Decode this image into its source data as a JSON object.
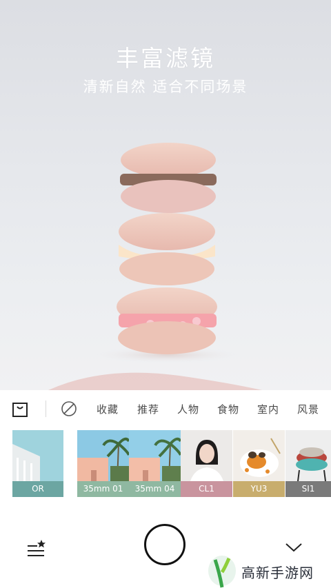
{
  "hero": {
    "title": "丰富滤镜",
    "subtitle": "清新自然 适合不同场景"
  },
  "category_bar": {
    "items": [
      "收藏",
      "推荐",
      "人物",
      "食物",
      "室内",
      "风景"
    ]
  },
  "filters": [
    {
      "label": "OR",
      "color": "#6ca6a2"
    },
    {
      "label": "35mm 01",
      "color": "#8fb8a1"
    },
    {
      "label": "35mm 04",
      "color": "#8fb8a1"
    },
    {
      "label": "CL1",
      "color": "#c9949e"
    },
    {
      "label": "YU3",
      "color": "#c8ad6d"
    },
    {
      "label": "SI1",
      "color": "#7a7a7a"
    }
  ],
  "watermark": {
    "text": "高新手游网"
  },
  "colors": {
    "shutter_border": "#111111",
    "category_text": "#4a4a4a"
  }
}
